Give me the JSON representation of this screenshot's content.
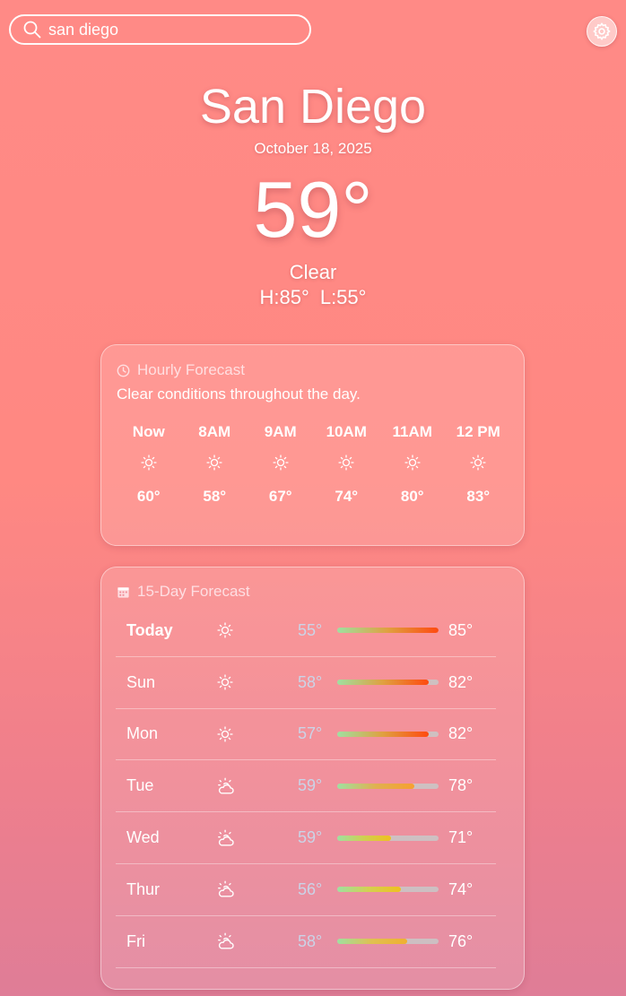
{
  "search": {
    "value": "san diego",
    "placeholder": ""
  },
  "current": {
    "city": "San Diego",
    "date": "October 18, 2025",
    "temp": "59°",
    "condition": "Clear",
    "high": "H:85°",
    "low": "L:55°"
  },
  "hourly": {
    "title": "Hourly Forecast",
    "summary": "Clear conditions throughout the day.",
    "hours": [
      {
        "time": "Now",
        "temp": "60°",
        "icon": "sun-icon"
      },
      {
        "time": "8AM",
        "temp": "58°",
        "icon": "sun-icon"
      },
      {
        "time": "9AM",
        "temp": "67°",
        "icon": "sun-icon"
      },
      {
        "time": "10AM",
        "temp": "74°",
        "icon": "sun-icon"
      },
      {
        "time": "11AM",
        "temp": "80°",
        "icon": "sun-icon"
      },
      {
        "time": "12 PM",
        "temp": "83°",
        "icon": "sun-icon"
      }
    ]
  },
  "daily": {
    "title": "15-Day Forecast",
    "days": [
      {
        "day": "Today",
        "low": "55°",
        "high": "85°",
        "icon": "sun-icon",
        "range_start": 0.0,
        "range_end": 1.0,
        "gradient": "linear-gradient(90deg,#9fe0a0,#e0a040,#ff4a10)"
      },
      {
        "day": "Sun",
        "low": "58°",
        "high": "82°",
        "icon": "sun-icon",
        "range_start": 0.0,
        "range_end": 0.9,
        "gradient": "linear-gradient(90deg,#9fe0a0,#e0a040,#ff4a10)"
      },
      {
        "day": "Mon",
        "low": "57°",
        "high": "82°",
        "icon": "sun-icon",
        "range_start": 0.0,
        "range_end": 0.9,
        "gradient": "linear-gradient(90deg,#9fe0a0,#e0a040,#ff4a10)"
      },
      {
        "day": "Tue",
        "low": "59°",
        "high": "78°",
        "icon": "partly-cloudy-icon",
        "range_start": 0.0,
        "range_end": 0.76,
        "gradient": "linear-gradient(90deg,#9fe0a0,#e0b050,#f7a030)"
      },
      {
        "day": "Wed",
        "low": "59°",
        "high": "71°",
        "icon": "partly-cloudy-icon",
        "range_start": 0.0,
        "range_end": 0.53,
        "gradient": "linear-gradient(90deg,#9fe0a0,#cfd050,#f0c020)"
      },
      {
        "day": "Thur",
        "low": "56°",
        "high": "74°",
        "icon": "partly-cloudy-icon",
        "range_start": 0.0,
        "range_end": 0.63,
        "gradient": "linear-gradient(90deg,#9fe0a0,#d4d050,#f0c020)"
      },
      {
        "day": "Fri",
        "low": "58°",
        "high": "76°",
        "icon": "partly-cloudy-icon",
        "range_start": 0.0,
        "range_end": 0.69,
        "gradient": "linear-gradient(90deg,#9fe0a0,#e0c050,#f0b030)"
      }
    ]
  },
  "colors": {
    "bg_top": "#ff8a86",
    "bg_bottom": "#df7d97",
    "low_temp": "#c8d7eb"
  }
}
